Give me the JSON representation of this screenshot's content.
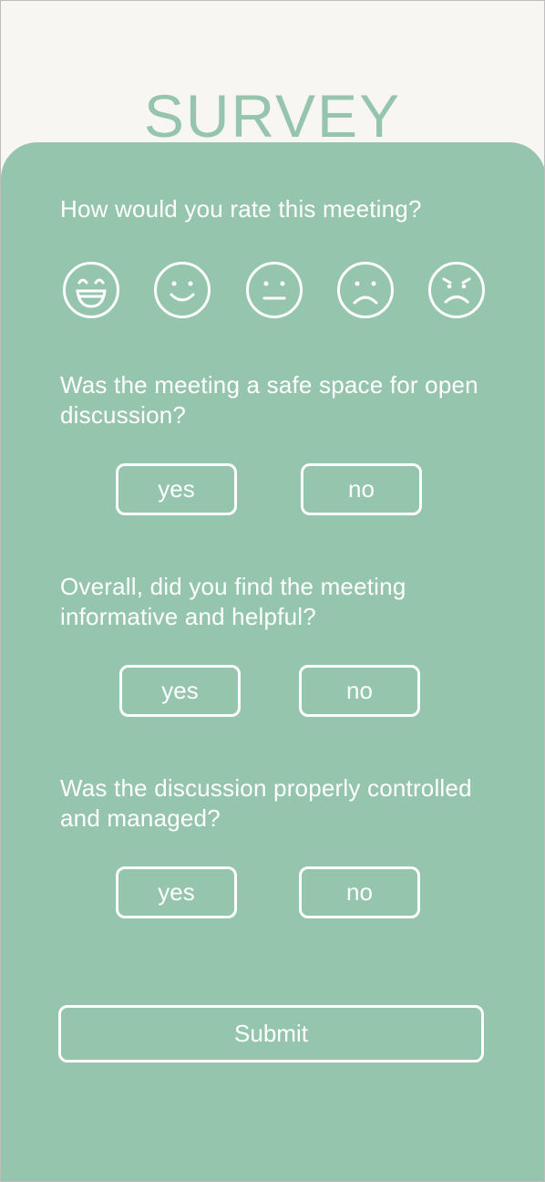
{
  "page": {
    "title": "SURVEY"
  },
  "rating": {
    "question": "How would you rate this meeting?",
    "faces": [
      {
        "icon": "grinning-face-icon"
      },
      {
        "icon": "smiling-face-icon"
      },
      {
        "icon": "neutral-face-icon"
      },
      {
        "icon": "frowning-face-icon"
      },
      {
        "icon": "angry-face-icon"
      }
    ]
  },
  "questions": [
    {
      "text": "Was the meeting a safe space for open discussion?",
      "yes": "yes",
      "no": "no"
    },
    {
      "text": "Overall, did you find the meeting informative and helpful?",
      "yes": "yes",
      "no": "no"
    },
    {
      "text": "Was the discussion properly controlled and managed?",
      "yes": "yes",
      "no": "no"
    }
  ],
  "submit_label": "Submit",
  "colors": {
    "accent": "#96c5ae",
    "background": "#f8f6f3",
    "foreground": "#ffffff"
  }
}
